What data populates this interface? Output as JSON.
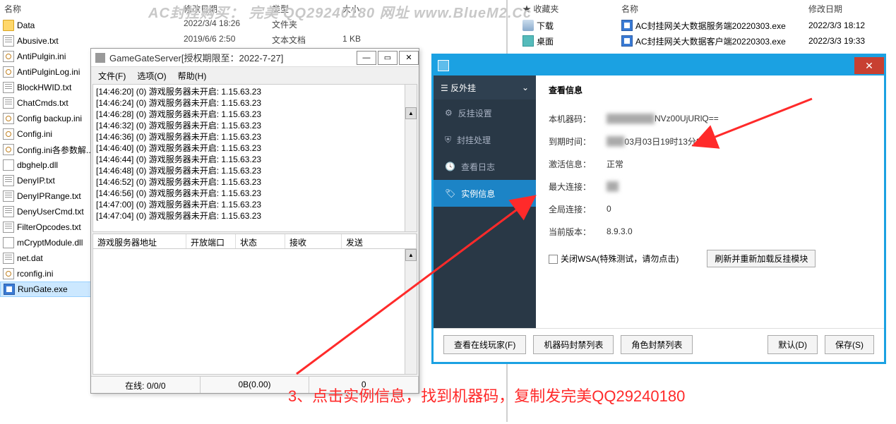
{
  "watermark": "AC封挂购买：  完美 QQ29240180  网址  www.BlueM2.Cc",
  "left": {
    "header_name": "名称",
    "files": [
      {
        "n": "Data",
        "t": "folder"
      },
      {
        "n": "Abusive.txt",
        "t": "txt"
      },
      {
        "n": "AntiPulgin.ini",
        "t": "ini"
      },
      {
        "n": "AntiPulginLog.ini",
        "t": "ini"
      },
      {
        "n": "BlockHWID.txt",
        "t": "txt"
      },
      {
        "n": "ChatCmds.txt",
        "t": "txt"
      },
      {
        "n": "Config backup.ini",
        "t": "ini"
      },
      {
        "n": "Config.ini",
        "t": "ini"
      },
      {
        "n": "Config.ini各参数解...",
        "t": "ini"
      },
      {
        "n": "dbghelp.dll",
        "t": "dll"
      },
      {
        "n": "DenyIP.txt",
        "t": "txt"
      },
      {
        "n": "DenyIPRange.txt",
        "t": "txt"
      },
      {
        "n": "DenyUserCmd.txt",
        "t": "txt"
      },
      {
        "n": "FilterOpcodes.txt",
        "t": "txt"
      },
      {
        "n": "mCryptModule.dll",
        "t": "dll"
      },
      {
        "n": "net.dat",
        "t": "txt"
      },
      {
        "n": "rconfig.ini",
        "t": "ini"
      },
      {
        "n": "RunGate.exe",
        "t": "exe",
        "sel": true
      }
    ]
  },
  "mid": {
    "h_date": "修改日期",
    "h_type": "类型",
    "h_size": "大小",
    "r1_date": "2022/3/4 18:26",
    "r1_type": "文件夹",
    "r2_date": "2019/6/6 2:50",
    "r2_type": "文本文档",
    "r2_size": "1 KB"
  },
  "right": {
    "h_fav": "收藏夹",
    "h_name": "名称",
    "h_date": "修改日期",
    "rows": [
      {
        "fav": "下载",
        "name": "AC封挂网关大数据服务端20220303.exe",
        "date": "2022/3/3 18:12"
      },
      {
        "fav": "桌面",
        "name": "AC封挂网关大数据客户端20220303.exe",
        "date": "2022/3/3 19:33"
      }
    ]
  },
  "ggs": {
    "title": "GameGateServer[授权期限至：2022-7-27]",
    "menu": {
      "file": "文件(F)",
      "option": "选项(O)",
      "help": "帮助(H)"
    },
    "log": "[14:46:20] (0) 游戏服务器未开启: 1.15.63.23\n[14:46:24] (0) 游戏服务器未开启: 1.15.63.23\n[14:46:28] (0) 游戏服务器未开启: 1.15.63.23\n[14:46:32] (0) 游戏服务器未开启: 1.15.63.23\n[14:46:36] (0) 游戏服务器未开启: 1.15.63.23\n[14:46:40] (0) 游戏服务器未开启: 1.15.63.23\n[14:46:44] (0) 游戏服务器未开启: 1.15.63.23\n[14:46:48] (0) 游戏服务器未开启: 1.15.63.23\n[14:46:52] (0) 游戏服务器未开启: 1.15.63.23\n[14:46:56] (0) 游戏服务器未开启: 1.15.63.23\n[14:47:00] (0) 游戏服务器未开启: 1.15.63.23\n[14:47:04] (0) 游戏服务器未开启: 1.15.63.23",
    "th": {
      "addr": "游戏服务器地址",
      "port": "开放端口",
      "state": "状态",
      "recv": "接收",
      "send": "发送"
    },
    "status": {
      "online": "在线: 0/0/0",
      "bytes": "0B(0.00)",
      "zero": "0"
    }
  },
  "cfg": {
    "nav_top": "反外挂",
    "nav_chev": "⌄",
    "nav": [
      {
        "label": "反挂设置"
      },
      {
        "label": "封挂处理"
      },
      {
        "label": "查看日志"
      },
      {
        "label": "实例信息",
        "active": true
      }
    ],
    "section_title": "查看信息",
    "rows": {
      "machine_l": "本机器码：",
      "machine_v": "NVz00UjURlQ==",
      "expire_l": "到期时间：",
      "expire_v": "03月03日19时13分32秒",
      "active_l": "激活信息：",
      "active_v": "正常",
      "maxconn_l": "最大连接：",
      "maxconn_v": "",
      "globconn_l": "全局连接：",
      "globconn_v": "0",
      "ver_l": "当前版本：",
      "ver_v": "8.9.3.0"
    },
    "chk_label": "关闭WSA(特殊测试，请勿点击)",
    "btn_reload": "刷新并重新加载反挂模块",
    "footer": {
      "online": "查看在线玩家(F)",
      "machineban": "机器码封禁列表",
      "roleban": "角色封禁列表",
      "default": "默认(D)",
      "save": "保存(S)"
    }
  },
  "anno": "3、点击实例信息，找到机器码，复制发完美QQ29240180"
}
